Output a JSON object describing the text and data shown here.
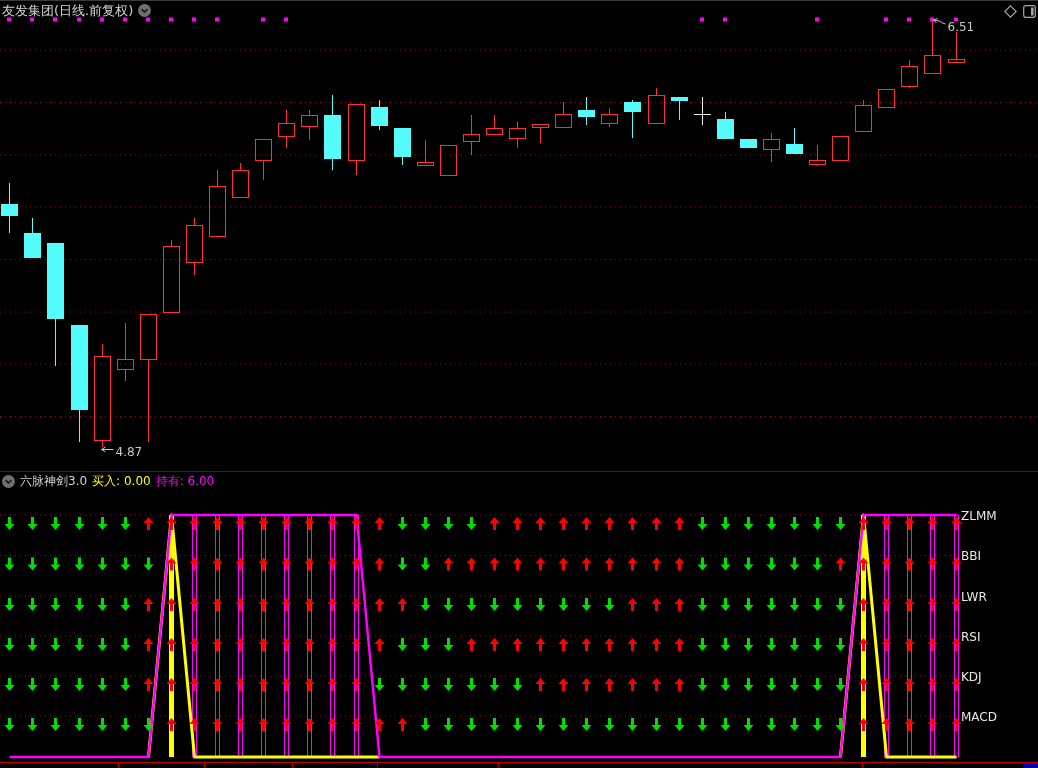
{
  "price_panel": {
    "title": "友发集团(日线.前复权)",
    "high_label": "6.51",
    "low_label": "4.87"
  },
  "indicator_panel": {
    "name": "六脉神剑3.0",
    "readouts": [
      {
        "kind": "buy",
        "text": "买入: 0.00"
      },
      {
        "kind": "hold",
        "text": "持有: 6.00"
      }
    ],
    "signal_rows": [
      {
        "label": "ZLMM",
        "up": [
          false,
          false,
          false,
          false,
          false,
          false,
          true,
          true,
          true,
          true,
          true,
          true,
          true,
          true,
          true,
          true,
          true,
          false,
          false,
          false,
          false,
          true,
          true,
          true,
          true,
          true,
          true,
          true,
          true,
          true,
          false,
          false,
          false,
          false,
          false,
          false,
          false,
          true,
          true,
          true,
          true,
          true
        ]
      },
      {
        "label": "BBI",
        "up": [
          false,
          false,
          false,
          false,
          false,
          false,
          false,
          true,
          true,
          true,
          true,
          true,
          true,
          true,
          true,
          true,
          true,
          false,
          false,
          true,
          true,
          true,
          true,
          true,
          true,
          true,
          true,
          true,
          true,
          true,
          false,
          false,
          false,
          false,
          false,
          false,
          true,
          true,
          true,
          true,
          true,
          true
        ]
      },
      {
        "label": "LWR",
        "up": [
          false,
          false,
          false,
          false,
          false,
          false,
          true,
          true,
          true,
          true,
          true,
          true,
          true,
          true,
          true,
          true,
          true,
          true,
          false,
          false,
          false,
          false,
          false,
          false,
          false,
          false,
          false,
          true,
          true,
          true,
          false,
          false,
          false,
          false,
          false,
          false,
          false,
          true,
          true,
          true,
          true,
          true
        ]
      },
      {
        "label": "RSI",
        "up": [
          false,
          false,
          false,
          false,
          false,
          false,
          true,
          true,
          true,
          true,
          true,
          true,
          true,
          true,
          true,
          true,
          true,
          false,
          false,
          false,
          true,
          true,
          true,
          true,
          true,
          true,
          true,
          true,
          true,
          true,
          false,
          false,
          false,
          false,
          false,
          false,
          false,
          true,
          true,
          true,
          true,
          true
        ]
      },
      {
        "label": "KDJ",
        "up": [
          false,
          false,
          false,
          false,
          false,
          false,
          true,
          true,
          true,
          true,
          true,
          true,
          true,
          true,
          true,
          true,
          false,
          false,
          false,
          false,
          false,
          false,
          false,
          true,
          true,
          true,
          true,
          true,
          true,
          true,
          false,
          false,
          false,
          false,
          false,
          false,
          false,
          true,
          true,
          true,
          true,
          true
        ]
      },
      {
        "label": "MACD",
        "up": [
          false,
          false,
          false,
          false,
          false,
          false,
          false,
          true,
          true,
          true,
          true,
          true,
          true,
          true,
          true,
          true,
          true,
          true,
          false,
          false,
          false,
          false,
          false,
          false,
          false,
          false,
          false,
          false,
          false,
          false,
          false,
          false,
          false,
          false,
          false,
          false,
          false,
          true,
          true,
          true,
          true,
          true
        ]
      }
    ]
  }
}
